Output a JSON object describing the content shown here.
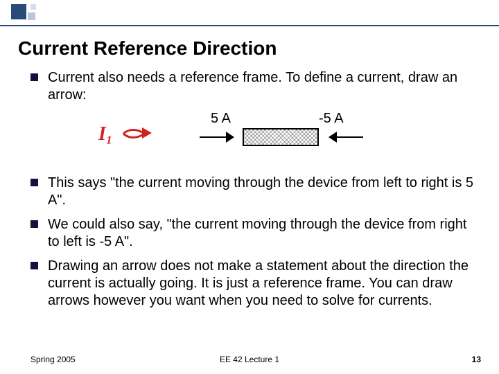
{
  "title": "Current Reference Direction",
  "bullets": [
    "Current also needs a reference frame.  To define a current, draw an arrow:",
    "This says \"the current moving through the device from left to right is 5 A\".",
    "We could also say, \"the current moving through the device from right to left is -5 A\".",
    "Drawing an arrow does not make a statement about the direction the current is actually going.  It is just a reference frame.  You can draw arrows however you want when you need to solve for currents."
  ],
  "diagram": {
    "left_label": "5 A",
    "right_label": "-5 A",
    "annotation": "I₁"
  },
  "footer": {
    "left": "Spring 2005",
    "center": "EE 42 Lecture 1",
    "right": "13"
  }
}
